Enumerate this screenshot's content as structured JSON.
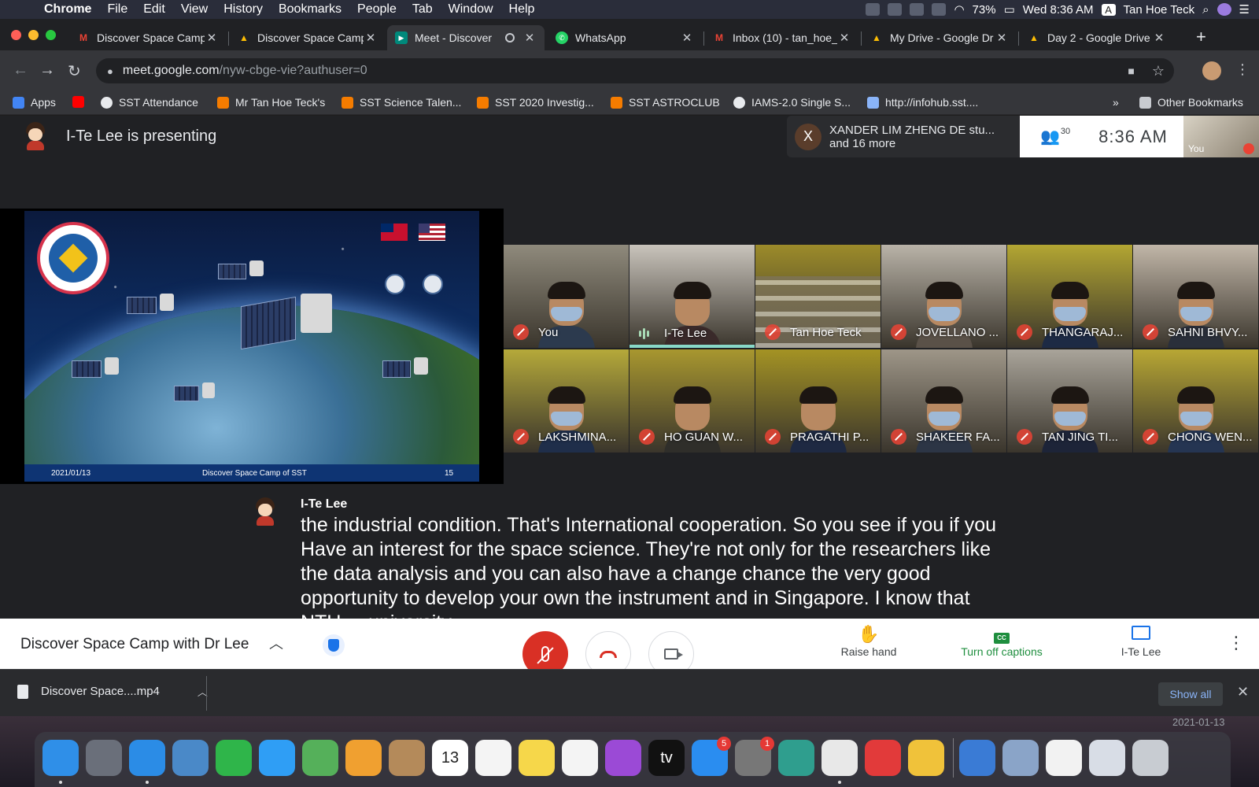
{
  "menubar": {
    "app": "Chrome",
    "items": [
      "File",
      "Edit",
      "View",
      "History",
      "Bookmarks",
      "People",
      "Tab",
      "Window",
      "Help"
    ],
    "battery": "73%",
    "datetime": "Wed 8:36 AM",
    "user_initial": "A",
    "user": "Tan Hoe Teck"
  },
  "tabs": [
    {
      "title": "Discover Space Camp",
      "icon": "gmail-icon"
    },
    {
      "title": "Discover Space Camp",
      "icon": "drive-icon"
    },
    {
      "title": "Meet - Discover",
      "icon": "meet-icon",
      "active": true
    },
    {
      "title": "WhatsApp",
      "icon": "whatsapp-icon"
    },
    {
      "title": "Inbox (10) - tan_hoe_",
      "icon": "gmail-icon"
    },
    {
      "title": "My Drive - Google Dr",
      "icon": "drive-icon"
    },
    {
      "title": "Day 2 - Google Drive",
      "icon": "drive-icon"
    }
  ],
  "address": {
    "host": "meet.google.com",
    "path": "/nyw-cbge-vie?authuser=0"
  },
  "bookmarks": [
    {
      "label": "Apps",
      "color": "#4285f4"
    },
    {
      "label": "",
      "color": "#ff0000"
    },
    {
      "label": "SST Attendance",
      "color": "#e8eaed"
    },
    {
      "label": "Mr Tan Hoe Teck's",
      "color": "#f57c00"
    },
    {
      "label": "SST Science Talen...",
      "color": "#f57c00"
    },
    {
      "label": "SST 2020 Investig...",
      "color": "#f57c00"
    },
    {
      "label": "SST ASTROCLUB",
      "color": "#f57c00"
    },
    {
      "label": "IAMS-2.0 Single S...",
      "color": "#e8eaed"
    },
    {
      "label": "http://infohub.sst....",
      "color": "#8ab4f8"
    }
  ],
  "bookmarks_more": "»",
  "other_bookmarks": "Other Bookmarks",
  "meet": {
    "presenting": "I-Te Lee is presenting",
    "participants_initial": "X",
    "participants_line1": "XANDER LIM ZHENG DE stu...",
    "participants_line2": "and 16 more",
    "people_count": "30",
    "clock": "8:36 AM",
    "self_label": "You",
    "slide": {
      "date": "2021/01/13",
      "title": "Discover Space Camp of SST",
      "page": "15"
    },
    "tiles": [
      {
        "name": "You",
        "muted": true,
        "bg": "#8f8a7c",
        "shirt": "#2c3a4e",
        "masked": true
      },
      {
        "name": "I-Te Lee",
        "muted": false,
        "bg": "#c9c4bc",
        "shirt": "#3a2a2a",
        "masked": false,
        "speaking": true
      },
      {
        "name": "Tan Hoe Teck",
        "muted": true,
        "bg": "#9c8b2a",
        "shirt": "#3b3a36",
        "masked": false,
        "room": true
      },
      {
        "name": "JOVELLANO ...",
        "muted": true,
        "bg": "#b9b3a8",
        "shirt": "#5a5148",
        "masked": true
      },
      {
        "name": "THANGARAJ...",
        "muted": true,
        "bg": "#b3a632",
        "shirt": "#1d2a44",
        "masked": true
      },
      {
        "name": "SAHNI BHVY...",
        "muted": true,
        "bg": "#c1b6a8",
        "shirt": "#2a2f3a",
        "masked": true
      },
      {
        "name": "LAKSHMINA...",
        "muted": true,
        "bg": "#b5a93a",
        "shirt": "#1f2e4a",
        "masked": true
      },
      {
        "name": "HO GUAN W...",
        "muted": true,
        "bg": "#a8972f",
        "shirt": "#2f2e2a",
        "masked": false
      },
      {
        "name": "PRAGATHI P...",
        "muted": true,
        "bg": "#a49324",
        "shirt": "#1e2942",
        "masked": false
      },
      {
        "name": "SHAKEER FA...",
        "muted": true,
        "bg": "#9e9688",
        "shirt": "#2c3545",
        "masked": true
      },
      {
        "name": "TAN JING TI...",
        "muted": true,
        "bg": "#a9a49a",
        "shirt": "#1d2438",
        "masked": true
      },
      {
        "name": "CHONG WEN...",
        "muted": true,
        "bg": "#b8a734",
        "shirt": "#253552",
        "masked": true
      }
    ],
    "caption_speaker": "I-Te Lee",
    "caption_text": "the industrial condition. That's International cooperation. So you see if you if you Have an interest for the space science. They're not only for the researchers like the data analysis and you can also have a change chance the very good opportunity to develop your own the instrument and in Singapore. I know that NTU ... university"
  },
  "meetbar": {
    "title": "Discover Space Camp with Dr Lee",
    "raise_hand": "Raise hand",
    "captions": "Turn off captions",
    "captions_badge": "CC",
    "presenter": "I-Te Lee"
  },
  "downloads": {
    "file": "Discover Space....mp4",
    "show_all": "Show all"
  },
  "desktop_clip_text": "2021-01-13",
  "dock": [
    {
      "icon": "finder-icon",
      "color": "#2f8fe8",
      "dot": true
    },
    {
      "icon": "launchpad-icon",
      "color": "#6a6f7a"
    },
    {
      "icon": "safari-icon",
      "color": "#2b8ce6",
      "dot": true
    },
    {
      "icon": "mail-eagle-icon",
      "color": "#4a89c8"
    },
    {
      "icon": "facetime-icon",
      "color": "#2fb54a"
    },
    {
      "icon": "messages-icon",
      "color": "#2f9ef5"
    },
    {
      "icon": "maps-icon",
      "color": "#55b05a"
    },
    {
      "icon": "photos-icon",
      "color": "#f0a030"
    },
    {
      "icon": "contacts-icon",
      "color": "#b48a5a"
    },
    {
      "icon": "calendar-icon",
      "color": "#ffffff",
      "text": "13"
    },
    {
      "icon": "reminders-icon",
      "color": "#f4f4f4"
    },
    {
      "icon": "notes-icon",
      "color": "#f6d74a"
    },
    {
      "icon": "music-icon",
      "color": "#f4f4f4"
    },
    {
      "icon": "podcasts-icon",
      "color": "#9b4ad6"
    },
    {
      "icon": "tv-icon",
      "color": "#111111",
      "text": "tv"
    },
    {
      "icon": "appstore-icon",
      "color": "#2a8df0",
      "badge": "5"
    },
    {
      "icon": "system-preferences-icon",
      "color": "#777777",
      "badge": "1"
    },
    {
      "icon": "globe-app-icon",
      "color": "#2f9e8e"
    },
    {
      "icon": "chrome-icon",
      "color": "#e8e8e8",
      "dot": true
    },
    {
      "icon": "security-app-icon",
      "color": "#e23a3a"
    },
    {
      "icon": "grid-app-icon",
      "color": "#f0c23a"
    },
    {
      "icon": "keynote-icon",
      "color": "#3a7bd5"
    },
    {
      "icon": "preview-icon",
      "color": "#8aa4c8"
    },
    {
      "icon": "textedit-icon",
      "color": "#f2f2f2"
    },
    {
      "icon": "downloads-stack-icon",
      "color": "#d8dde6"
    },
    {
      "icon": "trash-icon",
      "color": "#c8ccd2"
    }
  ]
}
